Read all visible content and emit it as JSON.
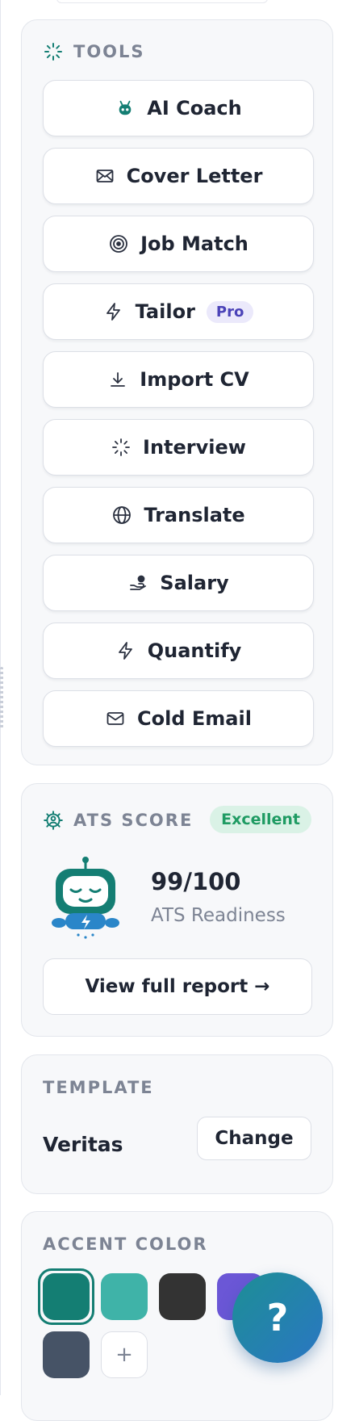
{
  "tools": {
    "title": "TOOLS",
    "items": [
      {
        "label": "AI Coach",
        "icon": "robot-icon"
      },
      {
        "label": "Cover Letter",
        "icon": "envelope-icon"
      },
      {
        "label": "Job Match",
        "icon": "target-icon"
      },
      {
        "label": "Tailor",
        "icon": "lightning-icon",
        "badge": "Pro"
      },
      {
        "label": "Import CV",
        "icon": "download-icon"
      },
      {
        "label": "Interview",
        "icon": "sparkle-loader-icon"
      },
      {
        "label": "Translate",
        "icon": "globe-icon"
      },
      {
        "label": "Salary",
        "icon": "hand-coins-icon"
      },
      {
        "label": "Quantify",
        "icon": "lightning-icon"
      },
      {
        "label": "Cold Email",
        "icon": "mail-icon"
      }
    ]
  },
  "ats": {
    "title": "ATS SCORE",
    "badge": "Excellent",
    "score": "99/100",
    "subtitle": "ATS Readiness",
    "report_button": "View full report →"
  },
  "template": {
    "title": "TEMPLATE",
    "name": "Veritas",
    "change_button": "Change"
  },
  "accent": {
    "title": "ACCENT COLOR",
    "selected": "#147e73",
    "swatches": [
      "#147e73",
      "#3fb3a8",
      "#333333",
      "#6b57d6",
      "#465366"
    ],
    "add_label": "+"
  },
  "help": {
    "label": "?"
  },
  "colors": {
    "brand": "#147e73",
    "success": "#1f9b63",
    "pro": "#4b43b8"
  }
}
